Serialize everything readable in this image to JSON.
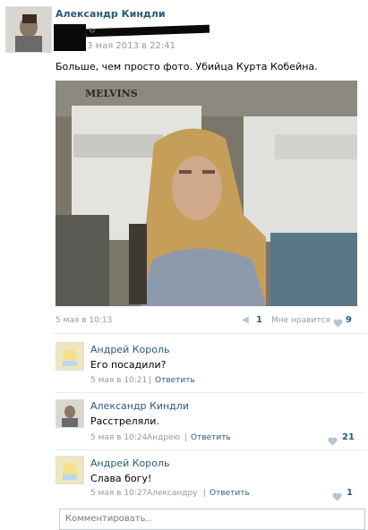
{
  "post": {
    "author": "Александр Киндли",
    "timestamp": "3 мая 2013 в 22:41",
    "text": "Больше, чем просто фото. Убийца Курта Кобейна.",
    "photo_sign": "MELVINS",
    "photo_date": "5 мая в 10:13",
    "share_count": "1",
    "like_label": "Мне нравится",
    "like_count": "9"
  },
  "comments": [
    {
      "author": "Андрей Король",
      "text": "Его посадили?",
      "time": "5 мая в 10:21",
      "reply_to": "",
      "reply_label": "Ответить",
      "likes": ""
    },
    {
      "author": "Александр Киндли",
      "text": "Расстреляли.",
      "time": "5 мая в 10:24",
      "reply_to": "Андрею",
      "reply_label": "Ответить",
      "likes": "21"
    },
    {
      "author": "Андрей Король",
      "text": "Слава богу!",
      "time": "5 мая в 10:27",
      "reply_to": "Александру",
      "reply_label": "Ответить",
      "likes": "1"
    }
  ],
  "comment_box": {
    "placeholder": "Комментировать.."
  },
  "icons": {
    "share": "share-arrow-icon",
    "like": "heart-icon"
  },
  "colors": {
    "link": "#2b587a",
    "muted": "#999999",
    "heart": "#b5c3d3"
  }
}
